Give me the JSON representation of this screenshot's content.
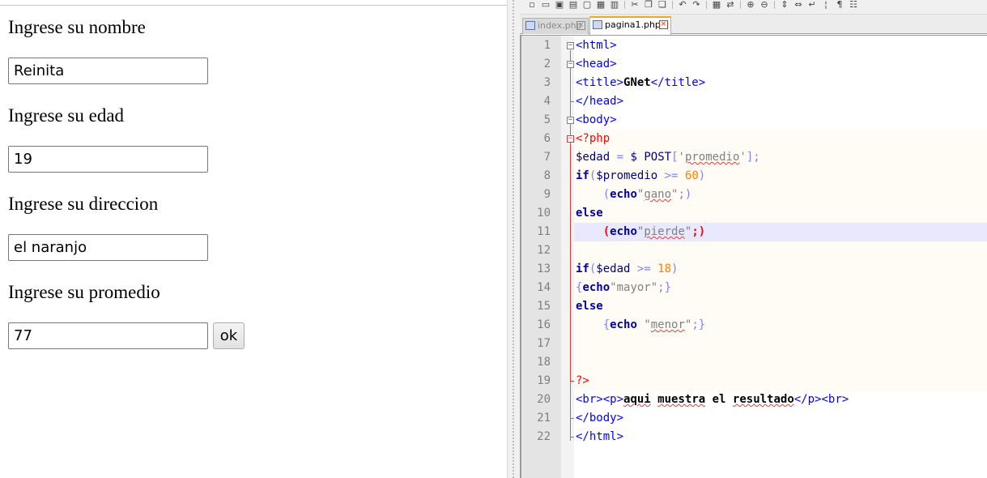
{
  "form": {
    "fields": [
      {
        "label": "Ingrese su nombre",
        "value": "Reinita"
      },
      {
        "label": "Ingrese su edad",
        "value": "19"
      },
      {
        "label": "Ingrese su direccion",
        "value": "el naranjo"
      },
      {
        "label": "Ingrese su promedio",
        "value": "77"
      }
    ],
    "submit_label": "ok"
  },
  "editor": {
    "tabs": [
      {
        "label": "index.php",
        "active": false
      },
      {
        "label": "pagina1.php",
        "active": true
      }
    ],
    "toolbar_icons": [
      "new-file-icon",
      "open-file-icon",
      "save-icon",
      "save-all-icon",
      "close-icon",
      "close-all-icon",
      "print-icon",
      "cut-icon",
      "copy-icon",
      "paste-icon",
      "undo-icon",
      "redo-icon",
      "find-icon",
      "replace-icon",
      "zoom-in-icon",
      "zoom-out-icon",
      "sync-vertical-icon",
      "sync-horizontal-icon",
      "word-wrap-icon",
      "indent-guide-icon",
      "show-all-chars-icon",
      "user-lang-icon"
    ],
    "lines": [
      {
        "n": "1",
        "text": "<html>"
      },
      {
        "n": "2",
        "text": "<head>"
      },
      {
        "n": "3",
        "text": "<title>GNet</title>"
      },
      {
        "n": "4",
        "text": "</head>"
      },
      {
        "n": "5",
        "text": "<body>"
      },
      {
        "n": "6",
        "text": "<?php"
      },
      {
        "n": "7",
        "text": "$edad = $ POST['promedio'];"
      },
      {
        "n": "8",
        "text": "if($promedio >= 60)"
      },
      {
        "n": "9",
        "text": "    (echo\"gano\";)"
      },
      {
        "n": "10",
        "text": "else"
      },
      {
        "n": "11",
        "text": "    (echo\"pierde\";)"
      },
      {
        "n": "12",
        "text": ""
      },
      {
        "n": "13",
        "text": "if($edad >= 18)"
      },
      {
        "n": "14",
        "text": "{echo\"mayor\";}"
      },
      {
        "n": "15",
        "text": "else"
      },
      {
        "n": "16",
        "text": "    {echo \"menor\";}"
      },
      {
        "n": "17",
        "text": ""
      },
      {
        "n": "18",
        "text": ""
      },
      {
        "n": "19",
        "text": "?>"
      },
      {
        "n": "20",
        "text": "<br><p>aqui muestra el resultado</p><br>"
      },
      {
        "n": "21",
        "text": "</body>"
      },
      {
        "n": "22",
        "text": "</html>"
      }
    ],
    "current_line": "11",
    "colors": {
      "tag": "#0000ff",
      "php_delimiter": "#ff0000",
      "keyword": "#0000a0",
      "operator": "#8080ff",
      "string": "#808080",
      "number": "#ff8000",
      "current_line_bg": "#e8e8ff",
      "active_tab_accent": "#f5a623"
    }
  }
}
